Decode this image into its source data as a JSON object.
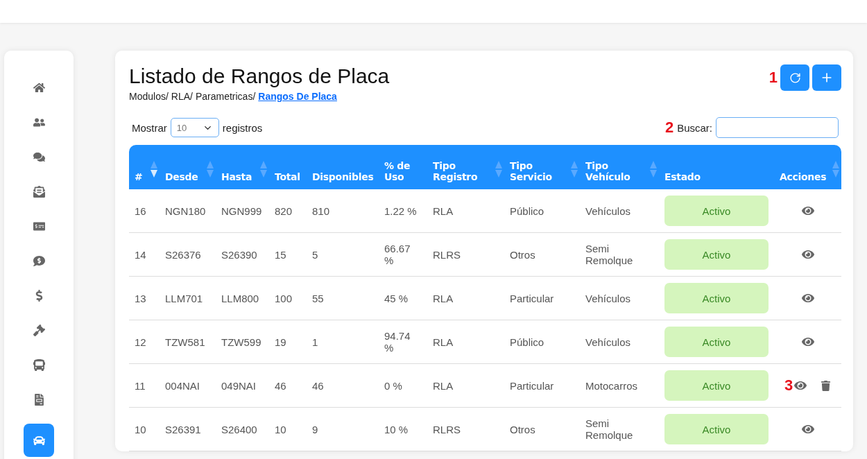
{
  "sidebar": {
    "items": [
      {
        "selected": false
      },
      {
        "selected": false
      },
      {
        "selected": false
      },
      {
        "selected": false
      },
      {
        "selected": false
      },
      {
        "selected": false
      },
      {
        "selected": false
      },
      {
        "selected": false
      },
      {
        "selected": false
      },
      {
        "selected": false
      },
      {
        "selected": true
      }
    ]
  },
  "page": {
    "title": "Listado de Rangos de Placa",
    "breadcrumb": [
      "Modulos/",
      "RLA/",
      "Parametricas/"
    ],
    "breadcrumb_current": "Rangos De Placa",
    "marker": "1"
  },
  "length": {
    "prefix": "Mostrar",
    "value": "10",
    "suffix": "registros"
  },
  "search": {
    "marker": "2",
    "label": "Buscar:"
  },
  "table": {
    "columns": [
      {
        "label": "#",
        "sortable": true,
        "sorted": true
      },
      {
        "label": "Desde",
        "sortable": true,
        "sorted": false
      },
      {
        "label": "Hasta",
        "sortable": true,
        "sorted": false
      },
      {
        "label": "Total",
        "sortable": false,
        "sorted": false
      },
      {
        "label": "Disponibles",
        "sortable": false,
        "sorted": false
      },
      {
        "label": "% de Uso",
        "sortable": false,
        "sorted": false
      },
      {
        "label": "Tipo Registro",
        "sortable": true,
        "sorted": false
      },
      {
        "label": "Tipo Servicio",
        "sortable": true,
        "sorted": false
      },
      {
        "label": "Tipo Vehículo",
        "sortable": true,
        "sorted": false
      },
      {
        "label": "Estado",
        "sortable": false,
        "sorted": false
      },
      {
        "label": "Acciones",
        "sortable": true,
        "sorted": false
      }
    ],
    "rows": [
      {
        "cells": [
          "16",
          "NGN180",
          "NGN999",
          "820",
          "810",
          "1.22 %",
          "RLA",
          "Público",
          "Vehículos"
        ],
        "status": "Activo",
        "deletable": false
      },
      {
        "cells": [
          "14",
          "S26376",
          "S26390",
          "15",
          "5",
          "66.67 %",
          "RLRS",
          "Otros",
          "Semi Remolque"
        ],
        "status": "Activo",
        "deletable": false
      },
      {
        "cells": [
          "13",
          "LLM701",
          "LLM800",
          "100",
          "55",
          "45 %",
          "RLA",
          "Particular",
          "Vehículos"
        ],
        "status": "Activo",
        "deletable": false
      },
      {
        "cells": [
          "12",
          "TZW581",
          "TZW599",
          "19",
          "1",
          "94.74 %",
          "RLA",
          "Público",
          "Vehículos"
        ],
        "status": "Activo",
        "deletable": false
      },
      {
        "cells": [
          "11",
          "004NAI",
          "049NAI",
          "46",
          "46",
          "0 %",
          "RLA",
          "Particular",
          "Motocarros"
        ],
        "status": "Activo",
        "deletable": true,
        "marker": "3"
      },
      {
        "cells": [
          "10",
          "S26391",
          "S26400",
          "10",
          "9",
          "10 %",
          "RLRS",
          "Otros",
          "Semi Remolque"
        ],
        "status": "Activo",
        "deletable": false
      }
    ]
  }
}
